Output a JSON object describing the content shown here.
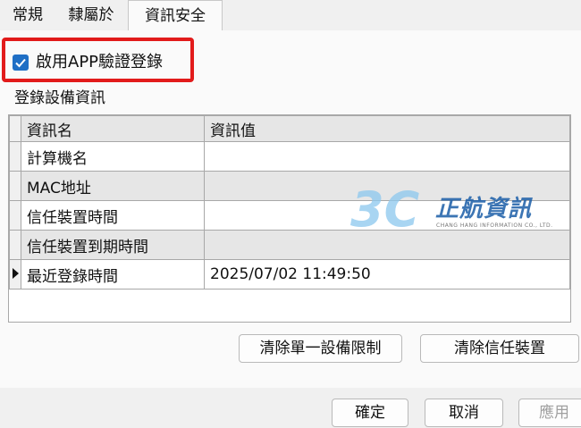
{
  "tabs": [
    {
      "label": "常規"
    },
    {
      "label": "隸屬於"
    },
    {
      "label": "資訊安全"
    }
  ],
  "app_auth": {
    "label": "啟用APP驗證登錄",
    "checked": true
  },
  "device_section": {
    "title": "登錄設備資訊",
    "columns": [
      "資訊名",
      "資訊值"
    ],
    "rows": [
      {
        "name": "計算機名",
        "value": ""
      },
      {
        "name": "MAC地址",
        "value": ""
      },
      {
        "name": "信任裝置時間",
        "value": ""
      },
      {
        "name": "信任裝置到期時間",
        "value": ""
      },
      {
        "name": "最近登錄時間",
        "value": "2025/07/02 11:49:50"
      }
    ]
  },
  "watermark": {
    "mark": "3C",
    "cn": "正航資訊",
    "en": "CHANG HANG INFORMATION CO., LTD."
  },
  "actions": {
    "clear_device_limit": "清除單一設備限制",
    "clear_trusted": "清除信任裝置"
  },
  "dialog": {
    "ok": "確定",
    "cancel": "取消",
    "apply": "應用"
  },
  "colors": {
    "highlight": "#e21b1b",
    "checkbox": "#1f6fc5"
  }
}
